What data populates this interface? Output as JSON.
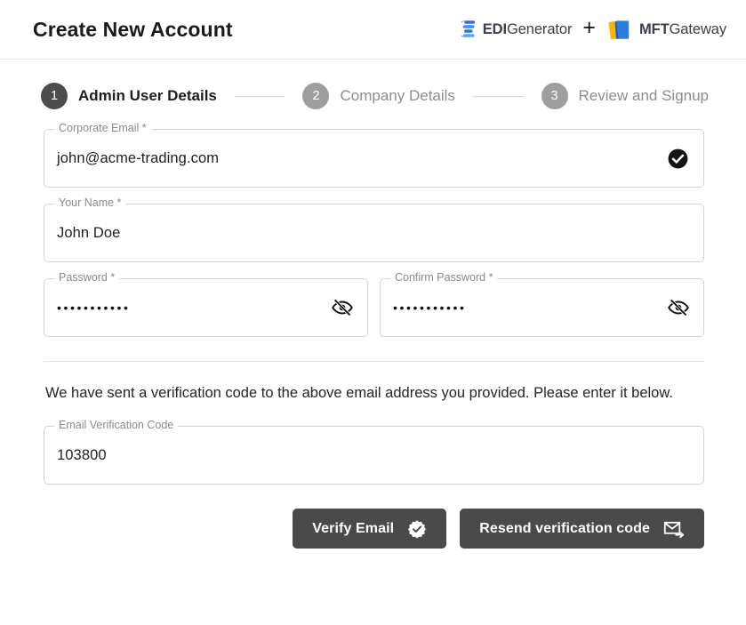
{
  "header": {
    "title": "Create New Account",
    "brands": [
      {
        "icon": "edigenerator-logo-icon",
        "bold": "EDI",
        "rest": "Generator"
      },
      {
        "icon": "mftgateway-logo-icon",
        "bold": "MFT",
        "rest": "Gateway"
      }
    ],
    "separator": "+"
  },
  "stepper": {
    "steps": [
      {
        "number": "1",
        "label": "Admin User Details",
        "state": "active"
      },
      {
        "number": "2",
        "label": "Company Details",
        "state": "inactive"
      },
      {
        "number": "3",
        "label": "Review and Signup",
        "state": "inactive"
      }
    ]
  },
  "form": {
    "email": {
      "label": "Corporate Email *",
      "value": "john@acme-trading.com",
      "placeholder": "Corporate Email",
      "adornment": "verified-check-icon"
    },
    "name": {
      "label": "Your Name *",
      "value": "John Doe",
      "placeholder": "Your Name"
    },
    "password": {
      "label": "Password *",
      "value": "•••••••••••",
      "placeholder": "Password",
      "adornment": "visibility-off-icon"
    },
    "confirm_password": {
      "label": "Confirm Password *",
      "value": "•••••••••••",
      "placeholder": "Confirm Password",
      "adornment": "visibility-off-icon"
    },
    "info_text": "We have sent a verification code to the above email address you provided. Please enter it below.",
    "verification_code": {
      "label": "Email Verification Code",
      "value": "103800",
      "placeholder": "Email Verification Code"
    }
  },
  "actions": {
    "verify": {
      "label": "Verify Email",
      "icon": "verified-badge-icon"
    },
    "resend": {
      "label": "Resend verification code",
      "icon": "forward-to-inbox-icon"
    }
  },
  "colors": {
    "button_bg": "#4a4a4a",
    "step_active": "#4c4c4c",
    "step_inactive": "#9e9e9e",
    "brand_blue": "#1f7ef6",
    "brand_orange": "#ffb400",
    "field_border": "#d2d4d8"
  }
}
